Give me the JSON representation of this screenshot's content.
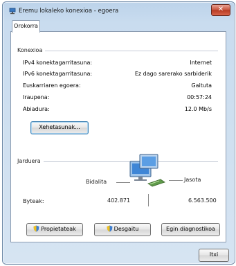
{
  "window": {
    "title": "Eremu lokaleko konexioa - egoera",
    "close_glyph": "✕"
  },
  "tab": {
    "label": "Orokorra"
  },
  "connection": {
    "heading": "Konexioa",
    "rows": [
      {
        "label": "IPv4 konektagarritasuna:",
        "value": "Internet"
      },
      {
        "label": "IPv6 konektagarritasuna:",
        "value": "Ez dago sarerako sarbiderik"
      },
      {
        "label": "Euskarriaren egoera:",
        "value": "Gaituta"
      },
      {
        "label": "Iraupena:",
        "value": "00:57:24"
      },
      {
        "label": "Abiadura:",
        "value": "12.0 Mb/s"
      }
    ],
    "details_button": "Xehetasunak..."
  },
  "activity": {
    "heading": "Jarduera",
    "sent_label": "Bidalita",
    "received_label": "Jasota",
    "bytes_label": "Byteak:",
    "bytes_sent": "402.871",
    "bytes_received": "6.563.500"
  },
  "buttons": {
    "properties": "Propietateak",
    "disable": "Desgaitu",
    "diagnose": "Egin diagnostikoa",
    "close": "Itxi"
  },
  "icons": [
    "network-icon",
    "shield-icon",
    "computers-icon",
    "close-icon"
  ]
}
